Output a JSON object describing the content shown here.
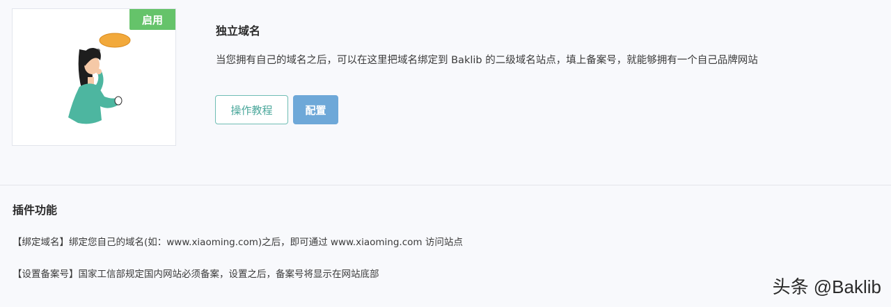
{
  "plugin": {
    "status_badge": "启用",
    "title": "独立域名",
    "description": "当您拥有自己的域名之后，可以在这里把域名绑定到 Baklib 的二级域名站点，填上备案号，就能够拥有一个自己品牌网站",
    "tutorial_button": "操作教程",
    "config_button": "配置",
    "illustration_bubble_text": "???"
  },
  "functions": {
    "title": "插件功能",
    "items": [
      {
        "text": "【绑定域名】绑定您自己的域名(如：www.xiaoming.com)之后，即可通过 www.xiaoming.com 访问站点"
      },
      {
        "text": "【设置备案号】国家工信部规定国内网站必须备案，设置之后，备案号将显示在网站底部"
      }
    ]
  },
  "watermark": "头条 @Baklib",
  "colors": {
    "badge_green": "#65c36a",
    "tutorial_border": "#6fbdb4",
    "config_blue": "#6ea8d8",
    "background": "#f8f9fc"
  }
}
